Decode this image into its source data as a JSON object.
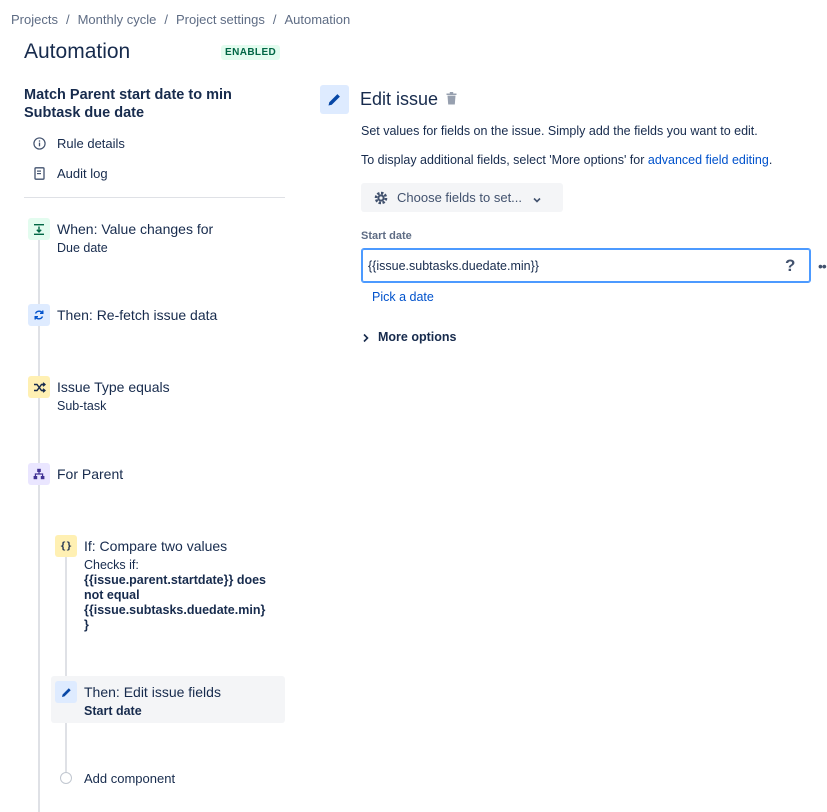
{
  "breadcrumb": [
    "Projects",
    "Monthly cycle",
    "Project settings",
    "Automation"
  ],
  "page_title": "Automation",
  "status_badge": "ENABLED",
  "rule_name": "Match Parent start date to min Subtask due date",
  "nav": {
    "rule_details": "Rule details",
    "audit_log": "Audit log"
  },
  "components": {
    "trigger": {
      "title": "When: Value changes for",
      "sub": "Due date",
      "icon": "value-change-icon"
    },
    "refetch": {
      "title": "Then: Re-fetch issue data",
      "icon": "refresh-icon"
    },
    "condition": {
      "title": "Issue Type equals",
      "sub": "Sub-task",
      "icon": "shuffle-icon"
    },
    "branch": {
      "title": "For Parent",
      "icon": "hierarchy-icon"
    },
    "if_compare": {
      "title": "If: Compare two values",
      "checks": "Checks if:",
      "expr_line1": "{{issue.parent.startdate}} does",
      "expr_line2": "not equal",
      "expr_line3": "{{issue.subtasks.duedate.min}",
      "expr_line4": "}",
      "icon": "braces-icon"
    },
    "edit_fields": {
      "title": "Then: Edit issue fields",
      "sub": "Start date",
      "icon": "pencil-icon"
    },
    "add_component": "Add component"
  },
  "panel": {
    "title": "Edit issue",
    "description1": "Set values for fields on the issue. Simply add the fields you want to edit.",
    "description2_prefix": "To display additional fields, select 'More options' for ",
    "description2_link": "advanced field editing",
    "description2_suffix": ".",
    "choose_fields": "Choose fields to set...",
    "field_label": "Start date",
    "field_value": "{{issue.subtasks.duedate.min}}",
    "help": "?",
    "pick_date": "Pick a date",
    "more_options": "More options"
  },
  "colors": {
    "accent": "#0052CC",
    "enabled_bg": "#E3FCEF",
    "enabled_text": "#006644"
  }
}
